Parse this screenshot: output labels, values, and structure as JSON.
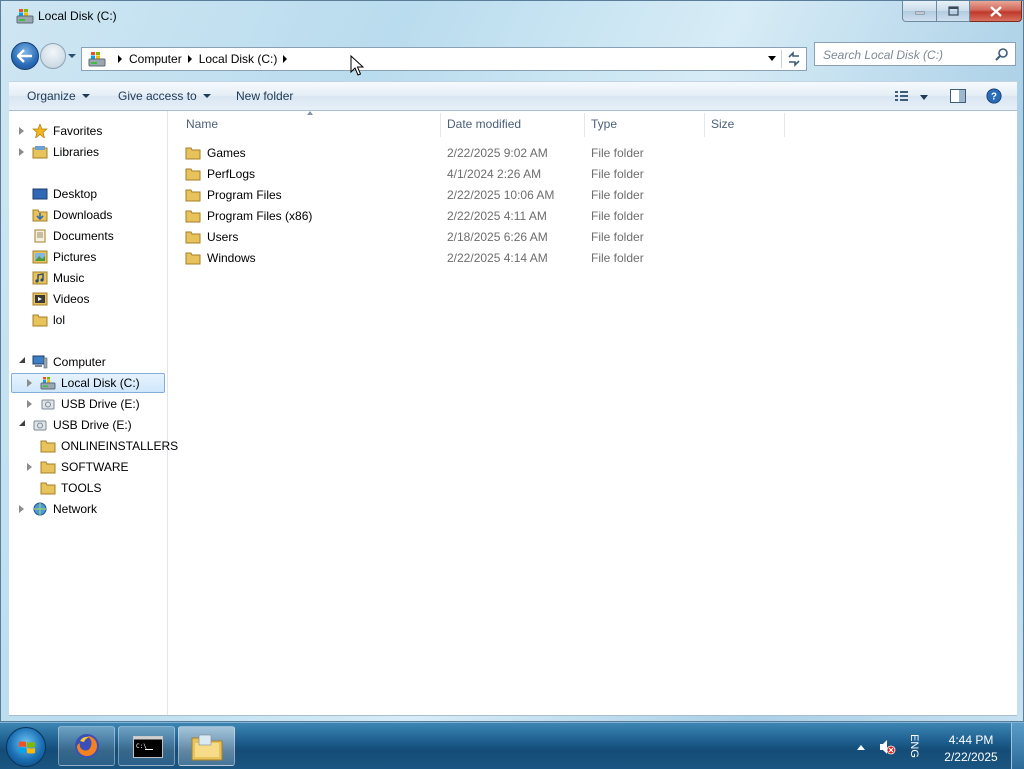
{
  "window": {
    "title": "Local Disk (C:)",
    "caption_buttons": [
      "minimize",
      "maximize",
      "close"
    ]
  },
  "address_bar": {
    "crumbs": [
      "Computer",
      "Local Disk (C:)"
    ],
    "search_placeholder": "Search Local Disk (C:)"
  },
  "toolbar": {
    "organize": "Organize",
    "give_access": "Give access to",
    "new_folder": "New folder"
  },
  "navpane": {
    "favorites": "Favorites",
    "libraries": "Libraries",
    "favorite_items": [
      "Desktop",
      "Downloads",
      "Documents",
      "Pictures",
      "Music",
      "Videos",
      "lol"
    ],
    "computer": "Computer",
    "local_disk": "Local Disk (C:)",
    "usb_drive_child": "USB Drive (E:)",
    "usb_drive": "USB Drive (E:)",
    "usb_items": [
      "ONLINEINSTALLERS",
      "SOFTWARE",
      "TOOLS"
    ],
    "network": "Network"
  },
  "columns": {
    "name": "Name",
    "date_modified": "Date modified",
    "type": "Type",
    "size": "Size"
  },
  "files": [
    {
      "name": "Games",
      "date": "2/22/2025 9:02 AM",
      "type": "File folder"
    },
    {
      "name": "PerfLogs",
      "date": "4/1/2024 2:26 AM",
      "type": "File folder"
    },
    {
      "name": "Program Files",
      "date": "2/22/2025 10:06 AM",
      "type": "File folder"
    },
    {
      "name": "Program Files (x86)",
      "date": "2/22/2025 4:11 AM",
      "type": "File folder"
    },
    {
      "name": "Users",
      "date": "2/18/2025 6:26 AM",
      "type": "File folder"
    },
    {
      "name": "Windows",
      "date": "2/22/2025 4:14 AM",
      "type": "File folder"
    }
  ],
  "taskbar": {
    "pinned": [
      "firefox-icon",
      "command-prompt-icon",
      "windows-explorer-icon"
    ],
    "language": "ENG",
    "time": "4:44 PM",
    "date": "2/22/2025"
  },
  "colors": {
    "accent": "#2a6cb8",
    "folder": "#e8c25a",
    "taskbar": "#1d5e8e"
  }
}
